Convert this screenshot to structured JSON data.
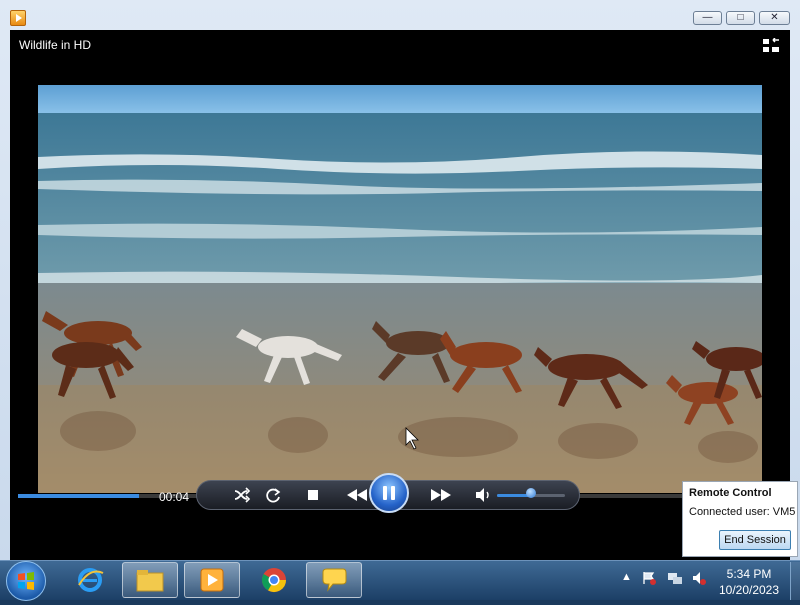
{
  "window": {
    "title": "Wildlife in HD"
  },
  "player": {
    "elapsed": "00:04",
    "progress": 0.18,
    "volume": 0.5,
    "state": "playing"
  },
  "remote_control": {
    "title": "Remote Control",
    "connected": "Connected user: VM5",
    "button": "End Session"
  },
  "taskbar": {
    "time": "5:34 PM",
    "date": "10/20/2023",
    "apps": [
      "internet-explorer-icon",
      "file-explorer-icon",
      "media-player-icon",
      "chrome-icon",
      "chat-icon"
    ]
  },
  "colors": {
    "accent": "#3b8be0",
    "taskbar": "#1c3f66"
  }
}
